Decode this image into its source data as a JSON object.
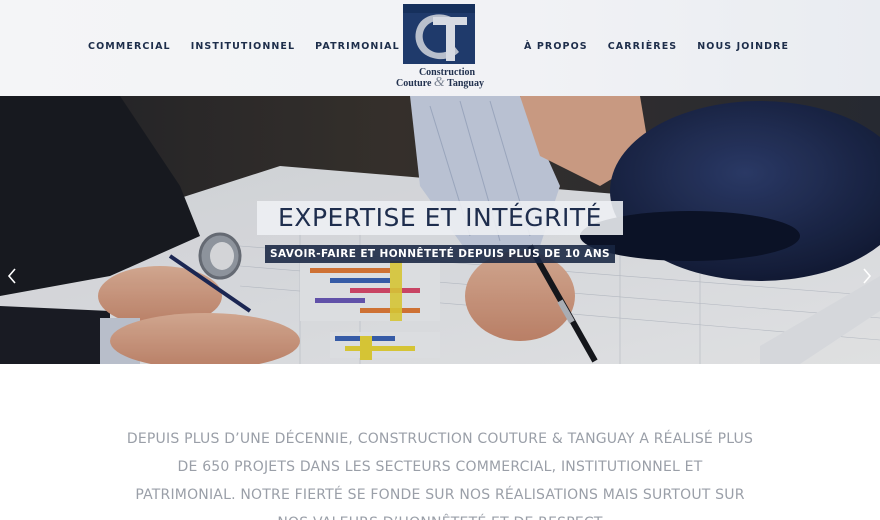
{
  "nav": {
    "left": [
      "COMMERCIAL",
      "INSTITUTIONNEL",
      "PATRIMONIAL"
    ],
    "right": [
      "À PROPOS",
      "CARRIÈRES",
      "NOUS JOINDRE"
    ]
  },
  "logo": {
    "line1": "Construction",
    "line2_a": "Couture ",
    "line2_amp": "&",
    "line2_b": " Tanguay"
  },
  "hero": {
    "title": "EXPERTISE ET INTÉGRITÉ",
    "subtitle": "SAVOIR-FAIRE ET HONNÊTETÉ DEPUIS PLUS DE 10 ANS",
    "prev_icon": "chevron-left-icon",
    "next_icon": "chevron-right-icon"
  },
  "intro": {
    "lines": [
      "DEPUIS PLUS D’UNE DÉCENNIE, CONSTRUCTION COUTURE & TANGUAY A RÉALISÉ PLUS",
      "DE 650 PROJETS DANS LES SECTEURS COMMERCIAL, INSTITUTIONNEL ET",
      "PATRIMONIAL. NOTRE FIERTÉ SE FONDE SUR NOS RÉALISATIONS MAIS SURTOUT SUR",
      "NOS VALEURS D’HONNÊTETÉ ET DE RESPECT"
    ]
  },
  "colors": {
    "brand_navy": "#1d2d4a",
    "caption_bg": "#182542",
    "intro_text": "#9a9fa8"
  }
}
